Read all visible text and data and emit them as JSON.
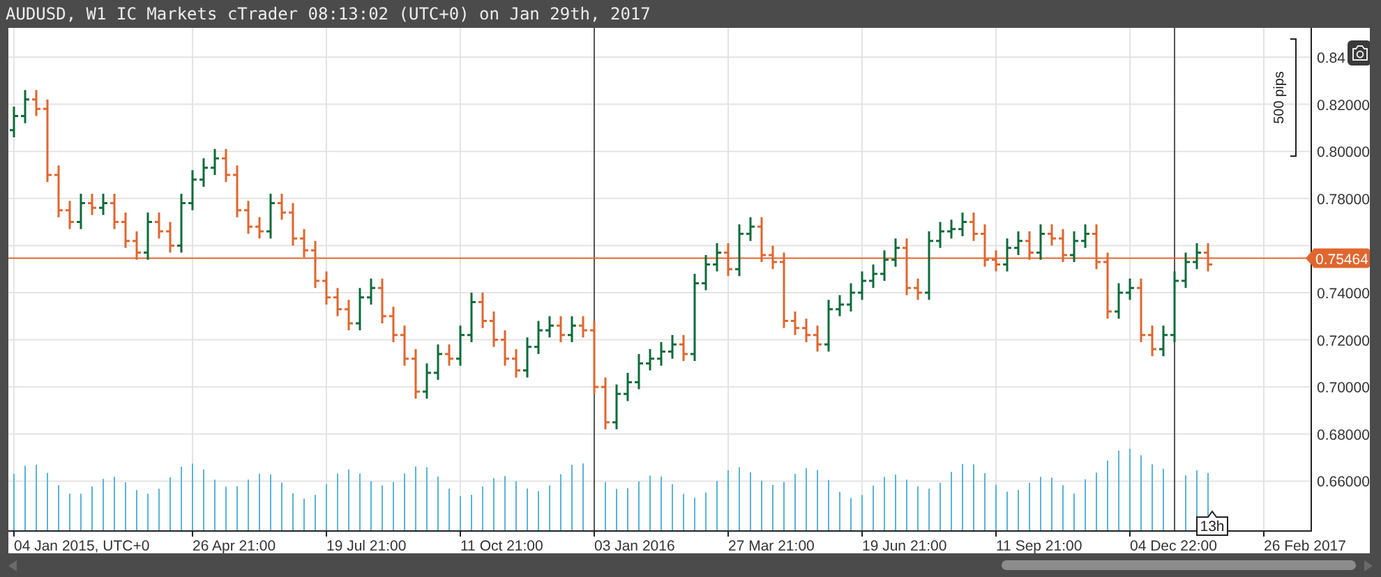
{
  "window": {
    "title": "AUDUSD, W1 IC Markets cTrader 08:13:02 (UTC+0) on Jan 29th, 2017"
  },
  "chart": {
    "current_price": {
      "label": "0.75464"
    },
    "range_marker": {
      "label": "500 pips"
    },
    "cursor_tooltip": {
      "label": "13h"
    },
    "price_axis": {
      "labels": [
        "0.84",
        "0.82000",
        "0.80000",
        "0.78000",
        "0.74000",
        "0.72000",
        "0.70000",
        "0.68000",
        "0.66000"
      ]
    },
    "time_axis": {
      "labels": [
        "04 Jan 2015, UTC+0",
        "26 Apr 21:00",
        "19 Jul 21:00",
        "11 Oct 21:00",
        "03 Jan 2016",
        "27 Mar 21:00",
        "19 Jun 21:00",
        "11 Sep 21:00",
        "04 Dec 22:00",
        "26 Feb 2017"
      ]
    }
  }
}
